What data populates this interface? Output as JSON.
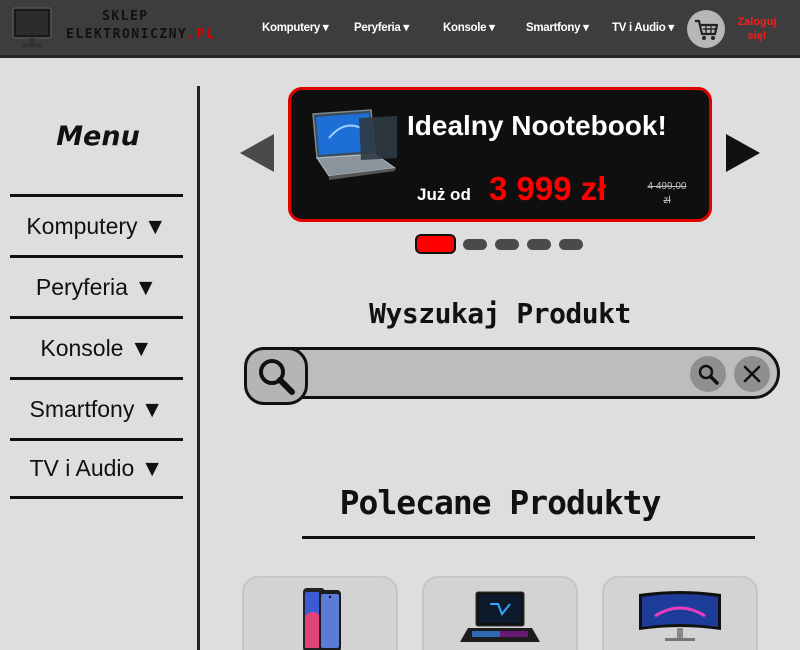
{
  "header": {
    "logo": {
      "line1": "SKLEP",
      "line2": "ELEKTRONICZNY",
      "suffix": ".PL"
    },
    "nav": [
      {
        "label": "Komputery ▾"
      },
      {
        "label": "Peryferia ▾"
      },
      {
        "label": "Konsole ▾"
      },
      {
        "label": "Smartfony ▾"
      },
      {
        "label": "TV i Audio ▾"
      }
    ],
    "cart_icon": "shopping-cart-icon",
    "login": {
      "line1": "Zaloguj",
      "line2": "się!"
    }
  },
  "sidebar": {
    "title": "Menu",
    "items": [
      {
        "label": "Komputery ▼"
      },
      {
        "label": "Peryferia ▼"
      },
      {
        "label": "Konsole ▼"
      },
      {
        "label": "Smartfony ▼"
      },
      {
        "label": "TV i Audio ▼"
      }
    ]
  },
  "banner": {
    "title": "Idealny Nootebook!",
    "from_label": "Już od",
    "price": "3 999 zł",
    "old_price_line1": "4 499,00",
    "old_price_line2": "zł",
    "slide_count": 5,
    "active_slide": 1,
    "prev_icon": "triangle-left-icon",
    "next_icon": "triangle-right-icon"
  },
  "search": {
    "title": "Wyszukaj Produkt",
    "value": "",
    "placeholder": "",
    "lead_icon": "magnifier-icon",
    "search_icon": "search-icon",
    "clear_icon": "close-icon"
  },
  "recommended": {
    "title": "Polecane Produkty",
    "products": [
      {
        "icon": "smartphone-image"
      },
      {
        "icon": "laptop-image"
      },
      {
        "icon": "curved-monitor-image"
      }
    ]
  },
  "colors": {
    "header_bg": "#3d3d3d",
    "page_bg": "#dedede",
    "accent_red": "#ff0000",
    "banner_bg": "#0f0f0f"
  }
}
